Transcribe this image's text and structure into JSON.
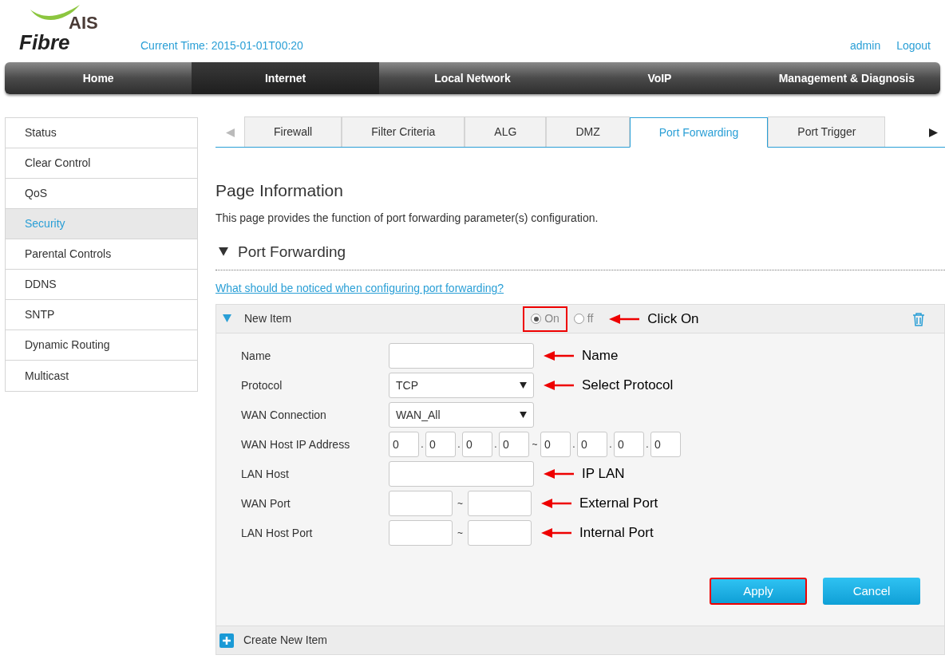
{
  "header": {
    "logo_top": "AIS",
    "logo_bottom": "Fibre",
    "current_time": "Current Time: 2015-01-01T00:20",
    "user": "admin",
    "logout": "Logout"
  },
  "nav": [
    {
      "label": "Home",
      "selected": false
    },
    {
      "label": "Internet",
      "selected": true
    },
    {
      "label": "Local Network",
      "selected": false
    },
    {
      "label": "VoIP",
      "selected": false
    },
    {
      "label": "Management & Diagnosis",
      "selected": false
    }
  ],
  "sidebar": {
    "items": [
      {
        "label": "Status",
        "selected": false
      },
      {
        "label": "Clear Control",
        "selected": false
      },
      {
        "label": "QoS",
        "selected": false
      },
      {
        "label": "Security",
        "selected": true
      },
      {
        "label": "Parental Controls",
        "selected": false
      },
      {
        "label": "DDNS",
        "selected": false
      },
      {
        "label": "SNTP",
        "selected": false
      },
      {
        "label": "Dynamic Routing",
        "selected": false
      },
      {
        "label": "Multicast",
        "selected": false
      }
    ]
  },
  "tabs": [
    {
      "label": "Firewall",
      "selected": false
    },
    {
      "label": "Filter Criteria",
      "selected": false
    },
    {
      "label": "ALG",
      "selected": false
    },
    {
      "label": "DMZ",
      "selected": false
    },
    {
      "label": "Port Forwarding",
      "selected": true
    },
    {
      "label": "Port Trigger",
      "selected": false
    }
  ],
  "page_title": "Page Information",
  "description": "This page provides the function of port forwarding parameter(s) configuration.",
  "section_title": "Port Forwarding",
  "help_link": "What should be noticed when configuring port forwarding?",
  "item": {
    "title": "New Item",
    "expanded": true,
    "radios": [
      {
        "label": "On",
        "selected": true,
        "highlighted": true
      },
      {
        "label": "ff",
        "selected": false,
        "highlighted": false
      }
    ],
    "radio_annotation": "Click On",
    "rows": [
      {
        "kind": "text",
        "label": "Name",
        "value": "",
        "annotation": "Name"
      },
      {
        "kind": "select",
        "label": "Protocol",
        "value": "TCP",
        "annotation": "Select Protocol"
      },
      {
        "kind": "select",
        "label": "WAN Connection",
        "value": "WAN_All"
      },
      {
        "kind": "ip",
        "label": "WAN Host IP Address",
        "start": [
          "0",
          "0",
          "0",
          "0"
        ],
        "dot": ".",
        "separator": "~",
        "end": [
          "0",
          "0",
          "0",
          "0"
        ]
      },
      {
        "kind": "text",
        "label": "LAN Host",
        "value": "",
        "annotation": "IP LAN"
      },
      {
        "kind": "range",
        "label": "WAN Port",
        "separator": "~",
        "annotation": "External Port"
      },
      {
        "kind": "range",
        "label": "LAN Host Port",
        "separator": "~",
        "annotation": "Internal Port"
      }
    ],
    "buttons": [
      {
        "label": "Apply",
        "highlighted": true
      },
      {
        "label": "Cancel",
        "highlighted": false
      }
    ]
  },
  "create_item": "Create New Item"
}
